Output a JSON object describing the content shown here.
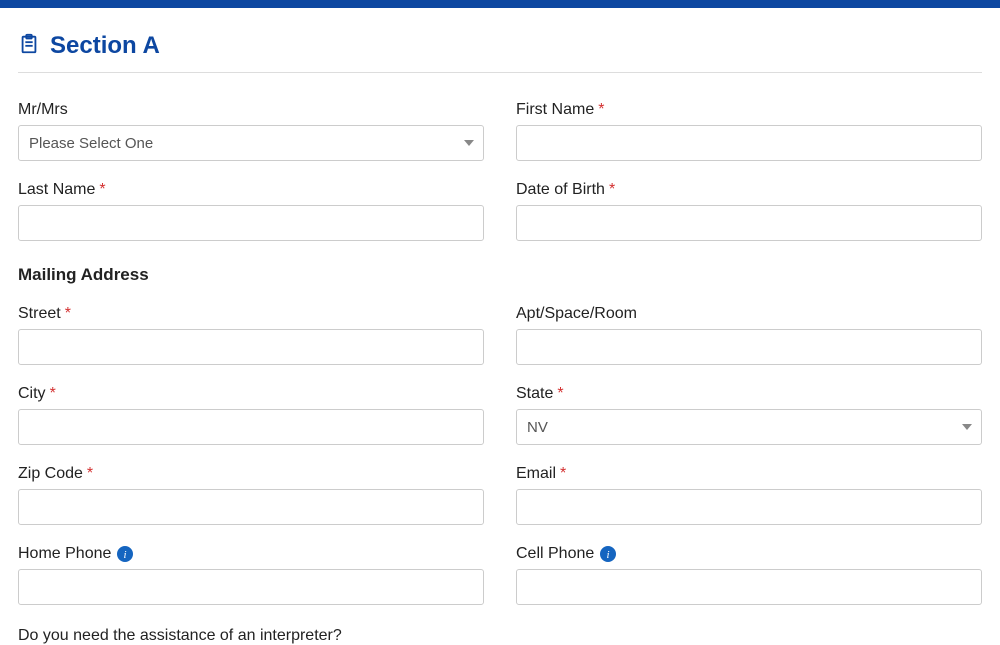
{
  "section": {
    "title": "Section A"
  },
  "labels": {
    "mrmrs": "Mr/Mrs",
    "first_name": "First Name",
    "last_name": "Last Name",
    "dob": "Date of Birth",
    "mailing_address_heading": "Mailing Address",
    "street": "Street",
    "apt": "Apt/Space/Room",
    "city": "City",
    "state": "State",
    "zip": "Zip Code",
    "email": "Email",
    "home_phone": "Home Phone",
    "cell_phone": "Cell Phone",
    "interpreter_question": "Do you need the assistance of an interpreter?"
  },
  "values": {
    "mrmrs_selected": "Please Select One",
    "first_name": "",
    "last_name": "",
    "dob": "",
    "street": "",
    "apt": "",
    "city": "",
    "state_selected": "NV",
    "zip": "",
    "email": "",
    "home_phone": "",
    "cell_phone": ""
  },
  "required": {
    "first_name": true,
    "last_name": true,
    "dob": true,
    "street": true,
    "city": true,
    "state": true,
    "zip": true,
    "email": true
  }
}
